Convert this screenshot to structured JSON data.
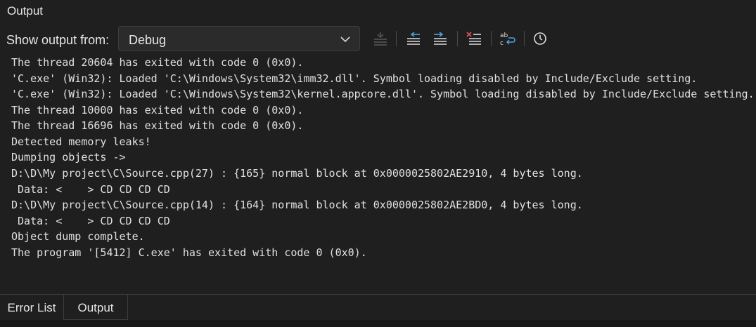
{
  "panel": {
    "title": "Output"
  },
  "toolbar": {
    "show_output_label": "Show output from:",
    "source_selected": "Debug"
  },
  "icons": {
    "find_message_in_code": "find-message-icon",
    "prev_message": "go-to-previous-message-icon",
    "next_message": "go-to-next-message-icon",
    "clear_all": "clear-all-icon",
    "word_wrap": "toggle-word-wrap-icon",
    "timestamp": "toggle-timestamp-icon"
  },
  "output": {
    "lines": [
      "The thread 20604 has exited with code 0 (0x0).",
      "'C.exe' (Win32): Loaded 'C:\\Windows\\System32\\imm32.dll'. Symbol loading disabled by Include/Exclude setting.",
      "'C.exe' (Win32): Loaded 'C:\\Windows\\System32\\kernel.appcore.dll'. Symbol loading disabled by Include/Exclude setting.",
      "The thread 10000 has exited with code 0 (0x0).",
      "The thread 16696 has exited with code 0 (0x0).",
      "Detected memory leaks!",
      "Dumping objects ->",
      "D:\\D\\My project\\C\\Source.cpp(27) : {165} normal block at 0x0000025802AE2910, 4 bytes long.",
      " Data: <    > CD CD CD CD",
      "D:\\D\\My project\\C\\Source.cpp(14) : {164} normal block at 0x0000025802AE2BD0, 4 bytes long.",
      " Data: <    > CD CD CD CD",
      "Object dump complete.",
      "The program '[5412] C.exe' has exited with code 0 (0x0)."
    ]
  },
  "tabs": [
    {
      "label": "Error List",
      "active": false
    },
    {
      "label": "Output",
      "active": true
    }
  ],
  "colors": {
    "background": "#1f1f1f",
    "text": "#e0e0e0",
    "dropdown_bg": "#2b2b2b",
    "clear_icon_accent": "#e05050",
    "nav_icon_accent": "#4aa3df"
  }
}
